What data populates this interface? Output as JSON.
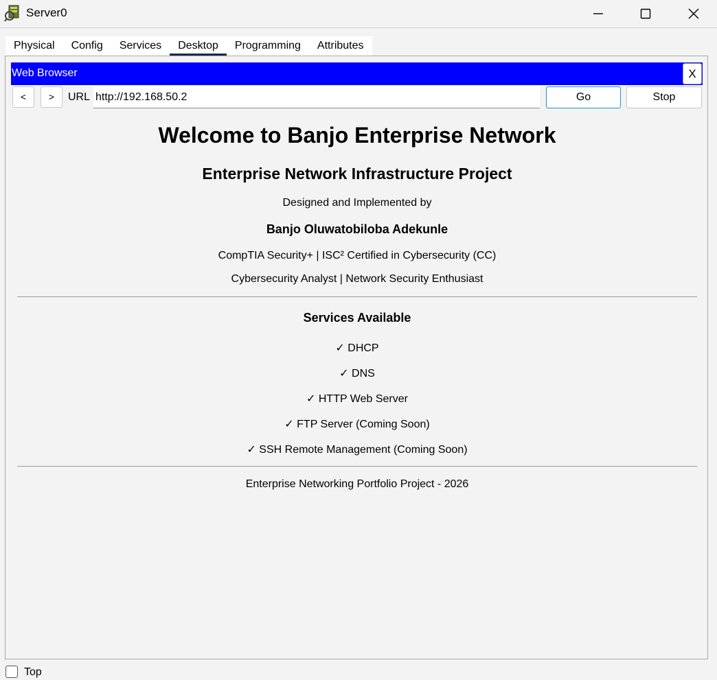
{
  "window": {
    "title": "Server0",
    "app_icon": "packet-tracer-server-icon",
    "minimize_icon": "minimize-icon",
    "maximize_icon": "maximize-icon",
    "close_icon": "close-icon"
  },
  "tabs": [
    {
      "label": "Physical"
    },
    {
      "label": "Config"
    },
    {
      "label": "Services"
    },
    {
      "label": "Desktop",
      "active": true
    },
    {
      "label": "Programming"
    },
    {
      "label": "Attributes"
    }
  ],
  "browser": {
    "title": "Web Browser",
    "close_label": "X",
    "back_label": "<",
    "forward_label": ">",
    "url_label": "URL",
    "url_value": "http://192.168.50.2",
    "go_label": "Go",
    "stop_label": "Stop",
    "accent_color": "#0000ff"
  },
  "page": {
    "heading": "Welcome to Banjo Enterprise Network",
    "subheading": "Enterprise Network Infrastructure Project",
    "designed_by": "Designed and Implemented by",
    "author": "Banjo Oluwatobiloba Adekunle",
    "certs": "CompTIA Security+ | ISC² Certified in Cybersecurity (CC)",
    "roles": "Cybersecurity Analyst | Network Security Enthusiast",
    "services_heading": "Services Available",
    "services": [
      "✓ DHCP",
      "✓ DNS",
      "✓ HTTP Web Server",
      "✓ FTP Server (Coming Soon)",
      "✓ SSH Remote Management (Coming Soon)"
    ],
    "footer": "Enterprise Networking Portfolio Project - 2026"
  },
  "bottom": {
    "top_label": "Top",
    "top_checked": false
  }
}
